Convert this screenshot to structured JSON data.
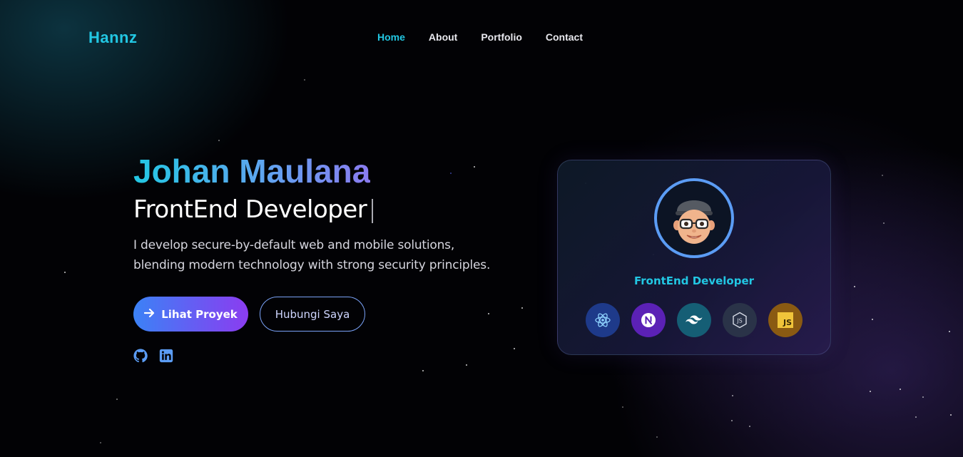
{
  "nav": {
    "logo": "Hannz",
    "items": [
      {
        "label": "Home",
        "active": true
      },
      {
        "label": "About",
        "active": false
      },
      {
        "label": "Portfolio",
        "active": false
      },
      {
        "label": "Contact",
        "active": false
      }
    ]
  },
  "hero": {
    "name": "Johan Maulana",
    "role": "FrontEnd Developer",
    "caret": "|",
    "description": "I develop secure-by-default web and mobile solutions, blending modern technology with strong security principles.",
    "primary_button": {
      "label": "Lihat Proyek",
      "icon": "arrow-right-icon"
    },
    "secondary_button": {
      "label": "Hubungi Saya"
    },
    "socials": [
      {
        "name": "github-icon"
      },
      {
        "name": "linkedin-icon"
      }
    ]
  },
  "card": {
    "avatar": "memoji-avatar",
    "role": "FrontEnd Developer",
    "tech": [
      {
        "name": "react-icon",
        "color": "#1e3a8a"
      },
      {
        "name": "nextjs-icon",
        "color": "#5b21b6"
      },
      {
        "name": "tailwind-icon",
        "color": "#155e75"
      },
      {
        "name": "nodejs-icon",
        "color": "#2a3348"
      },
      {
        "name": "javascript-icon",
        "color": "#8a5a12",
        "label": "JS"
      }
    ]
  },
  "colors": {
    "accent": "#22c7e3",
    "gradient_start": "#3b82f6",
    "gradient_end": "#8b3cf0",
    "ring": "#5b9cf4"
  }
}
